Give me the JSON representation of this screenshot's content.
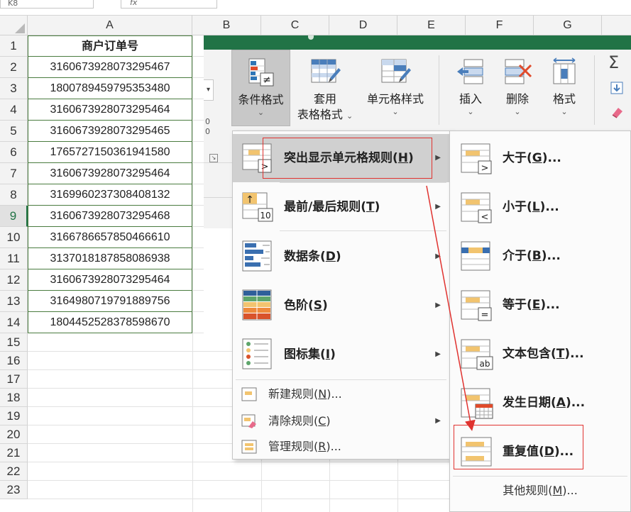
{
  "formula_bar": {
    "name_box": "K8",
    "fx_text": "fx"
  },
  "columns": [
    "A",
    "B",
    "C",
    "D",
    "E",
    "F",
    "G"
  ],
  "rows": [
    "1",
    "2",
    "3",
    "4",
    "5",
    "6",
    "7",
    "8",
    "9",
    "10",
    "11",
    "12",
    "13",
    "14",
    "15",
    "16",
    "17",
    "18",
    "19",
    "20",
    "21",
    "22",
    "23"
  ],
  "active_row": "9",
  "sheet": {
    "header": "商户订单号",
    "values": [
      "3160673928073295467",
      "1800789459795353480",
      "3160673928073295464",
      "3160673928073295465",
      "1765727150361941580",
      "3160673928073295464",
      "3169960237308408132",
      "3160673928073295468",
      "3166786657850466610",
      "3137018187858086938",
      "3160673928073295464",
      "3164980719791889756",
      "1804452528378598670"
    ]
  },
  "ribbon": {
    "accent": "#217346",
    "conditional_formatting": "条件格式",
    "format_as_table_line1": "套用",
    "format_as_table_line2": "表格格式",
    "cell_styles": "单元格样式",
    "insert": "插入",
    "delete": "删除",
    "format": "格式",
    "sum_symbol": "Σ",
    "fragment_numbers": "0\n0"
  },
  "menu": {
    "highlight_rules": {
      "text": "突出显示单元格规则(",
      "key": "H",
      "tail": ")"
    },
    "top_bottom_rules": {
      "text": "最前/最后规则(",
      "key": "T",
      "tail": ")"
    },
    "data_bars": {
      "text": "数据条(",
      "key": "D",
      "tail": ")"
    },
    "color_scales": {
      "text": "色阶(",
      "key": "S",
      "tail": ")"
    },
    "icon_sets": {
      "text": "图标集(",
      "key": "I",
      "tail": ")"
    },
    "new_rule": {
      "text": "新建规则(",
      "key": "N",
      "tail": ")..."
    },
    "clear_rules": {
      "text": "清除规则(",
      "key": "C",
      "tail": ")"
    },
    "manage_rules": {
      "text": "管理规则(",
      "key": "R",
      "tail": ")..."
    }
  },
  "submenu": {
    "greater_than": {
      "text": "大于(",
      "key": "G",
      "tail": ")..."
    },
    "less_than": {
      "text": "小于(",
      "key": "L",
      "tail": ")..."
    },
    "between": {
      "text": "介于(",
      "key": "B",
      "tail": ")..."
    },
    "equal_to": {
      "text": "等于(",
      "key": "E",
      "tail": ")..."
    },
    "text_contains": {
      "text": "文本包含(",
      "key": "T",
      "tail": ")..."
    },
    "date_occurring": {
      "text": "发生日期(",
      "key": "A",
      "tail": ")..."
    },
    "duplicate_values": {
      "text": "重复值(",
      "key": "D",
      "tail": ")..."
    },
    "more_rules": {
      "text": "其他规则(",
      "key": "M",
      "tail": ")..."
    }
  },
  "icons": {
    "icon_10": "10",
    "icon_ab": "ab",
    "icon_gt": ">",
    "icon_lt": "<",
    "icon_eq": "=",
    "icon_ne": "≠",
    "icon_up": "↑"
  },
  "annotation_color": "#e0322f"
}
